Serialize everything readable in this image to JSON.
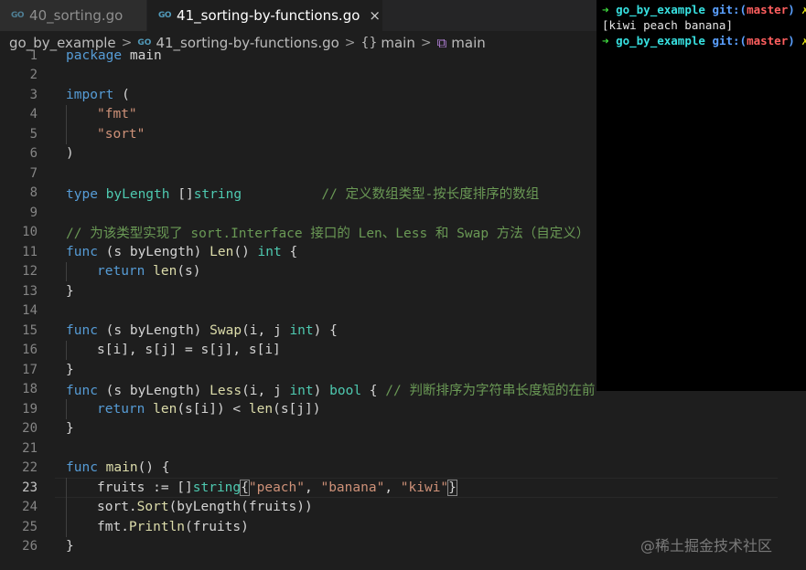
{
  "tabs": [
    {
      "icon": "GO",
      "label": "40_sorting.go"
    },
    {
      "icon": "GO",
      "label": "41_sorting-by-functions.go",
      "close": "×"
    }
  ],
  "breadcrumb": {
    "folder": "go_by_example",
    "file": "41_sorting-by-functions.go",
    "sep": ">",
    "brace": "{}",
    "func1": "main",
    "func2": "main"
  },
  "editor": {
    "line_numbers": [
      "1",
      "2",
      "3",
      "4",
      "5",
      "6",
      "7",
      "8",
      "9",
      "10",
      "11",
      "12",
      "13",
      "14",
      "15",
      "16",
      "17",
      "18",
      "19",
      "20",
      "21",
      "22",
      "23",
      "24",
      "25",
      "26"
    ],
    "current_line": "23",
    "lines": {
      "l1": {
        "a": "package",
        "b": " main"
      },
      "l3": {
        "a": "import",
        "b": " ("
      },
      "l4": {
        "s": "\"fmt\""
      },
      "l5": {
        "s": "\"sort\""
      },
      "l6": {
        "b": ")"
      },
      "l8": {
        "a": "type",
        "t": " byLength",
        "b": " []",
        "k2": "string",
        "c": "          // 定义数组类型-按长度排序的数组"
      },
      "l10": {
        "c": "// 为该类型实现了 sort.Interface 接口的 Len、Less 和 Swap 方法（自定义）"
      },
      "l11": {
        "a": "func",
        "b": " (s byLength) ",
        "f": "Len",
        "b2": "() ",
        "k2": "int",
        "b3": " {"
      },
      "l12": {
        "a": "return",
        "f": " len",
        "b": "(s)"
      },
      "l13": {
        "b": "}"
      },
      "l15": {
        "a": "func",
        "b": " (s byLength) ",
        "f": "Swap",
        "b2": "(i, j ",
        "k2": "int",
        "b3": ") {"
      },
      "l16": {
        "b": "s[i], s[j] = s[j], s[i]"
      },
      "l17": {
        "b": "}"
      },
      "l18": {
        "a": "func",
        "b": " (s byLength) ",
        "f": "Less",
        "b2": "(i, j ",
        "k2": "int",
        "b3": ") ",
        "k3": "bool",
        "b4": " { ",
        "c": "// 判断排序为字符串长度短的在前"
      },
      "l19": {
        "a": "return",
        "f": " len",
        "b": "(s[i]) < ",
        "f2": "len",
        "b2": "(s[j])"
      },
      "l20": {
        "b": "}"
      },
      "l22": {
        "a": "func",
        "f": " main",
        "b": "() {"
      },
      "l23": {
        "b": "fruits := []",
        "k2": "string",
        "b2": "{",
        "s1": "\"peach\"",
        "b3": ", ",
        "s2": "\"banana\"",
        "b4": ", ",
        "s3": "\"kiwi\"",
        "b5": "}"
      },
      "l24": {
        "b": "sort.",
        "f": "Sort",
        "b2": "(byLength(fruits))"
      },
      "l25": {
        "b": "fmt.",
        "f": "Println",
        "b2": "(fruits)"
      },
      "l26": {
        "b": "}"
      }
    }
  },
  "terminal": {
    "arrow": "➜",
    "dir": "go_by_example",
    "git": "git:(",
    "branch": "master",
    "git_close": ")",
    "x": "✗",
    "output": "[kiwi peach banana]"
  },
  "watermark": "@稀土掘金技术社区",
  "colors": {
    "keyword": "#569cd6",
    "type": "#4ec9b0",
    "string": "#ce9178",
    "function": "#dcdcaa",
    "comment": "#6a9955"
  }
}
